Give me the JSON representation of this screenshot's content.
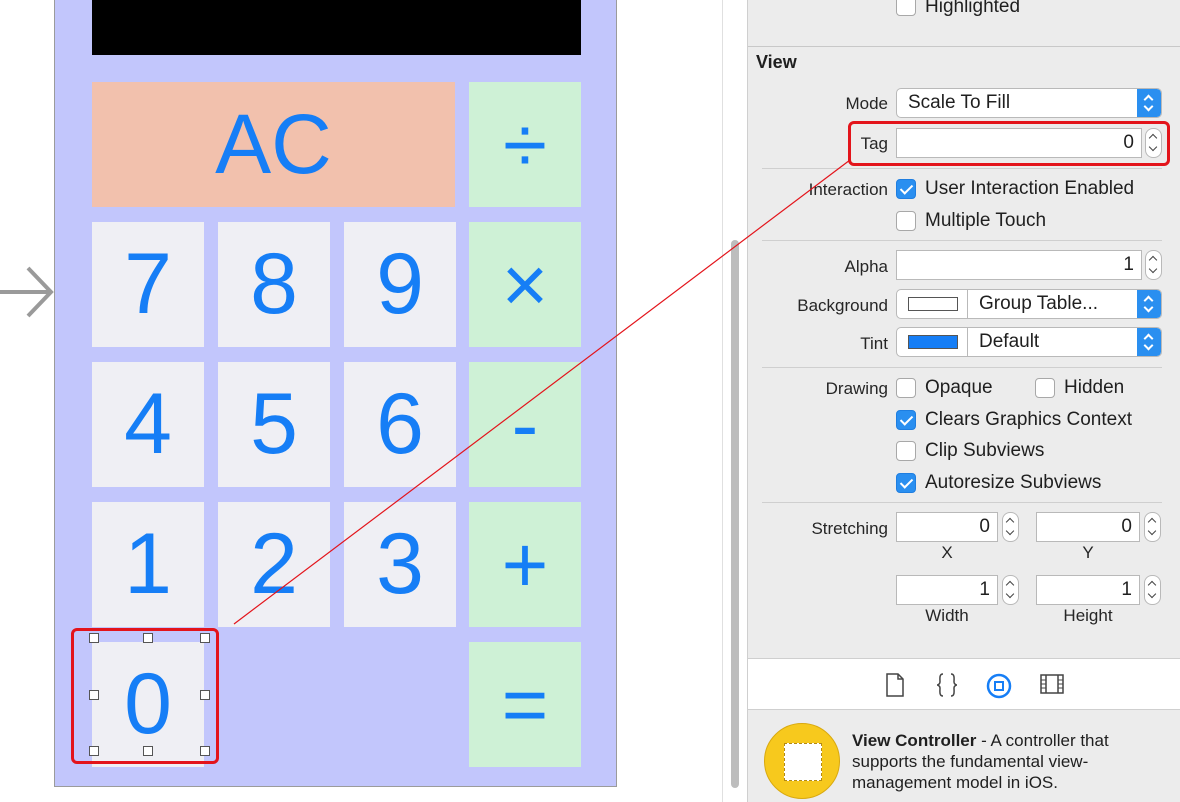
{
  "calculator": {
    "keys": {
      "ac": "AC",
      "divide": "÷",
      "seven": "7",
      "eight": "8",
      "nine": "9",
      "multiply": "×",
      "four": "4",
      "five": "5",
      "six": "6",
      "minus": "-",
      "one": "1",
      "two": "2",
      "three": "3",
      "plus": "+",
      "zero": "0",
      "equals": "="
    },
    "colors": {
      "device_background": "#c2c6fc",
      "number_key": "#efeff4",
      "operator_key": "#cef1d6",
      "clear_key": "#f2c1ad",
      "key_text": "#167ef6",
      "selection": "#e3141b"
    }
  },
  "inspector": {
    "highlighted_label": "Highlighted",
    "highlighted_checked": false,
    "section_title": "View",
    "mode": {
      "label": "Mode",
      "value": "Scale To Fill"
    },
    "tag": {
      "label": "Tag",
      "value": "0"
    },
    "interaction": {
      "label": "Interaction",
      "user_interaction_enabled": {
        "label": "User Interaction Enabled",
        "checked": true
      },
      "multiple_touch": {
        "label": "Multiple Touch",
        "checked": false
      }
    },
    "alpha": {
      "label": "Alpha",
      "value": "1"
    },
    "background": {
      "label": "Background",
      "value": "Group Table...",
      "swatch_color": "#ffffff"
    },
    "tint": {
      "label": "Tint",
      "value": "Default",
      "swatch_color": "#167ef6"
    },
    "drawing": {
      "label": "Drawing",
      "opaque": {
        "label": "Opaque",
        "checked": false
      },
      "hidden": {
        "label": "Hidden",
        "checked": false
      },
      "clears_graphics_context": {
        "label": "Clears Graphics Context",
        "checked": true
      },
      "clip_subviews": {
        "label": "Clip Subviews",
        "checked": false
      },
      "autoresize_subviews": {
        "label": "Autoresize Subviews",
        "checked": true
      }
    },
    "stretching": {
      "label": "Stretching",
      "x": {
        "caption": "X",
        "value": "0"
      },
      "y": {
        "caption": "Y",
        "value": "0"
      },
      "width": {
        "caption": "Width",
        "value": "1"
      },
      "height": {
        "caption": "Height",
        "value": "1"
      }
    }
  },
  "library": {
    "tabs": [
      "file-template-icon",
      "code-snippet-icon",
      "object-library-icon",
      "media-library-icon"
    ],
    "selected_tab": "object-library-icon",
    "item": {
      "title": "View Controller",
      "description": " - A controller that supports the fundamental view-management model in iOS."
    }
  }
}
